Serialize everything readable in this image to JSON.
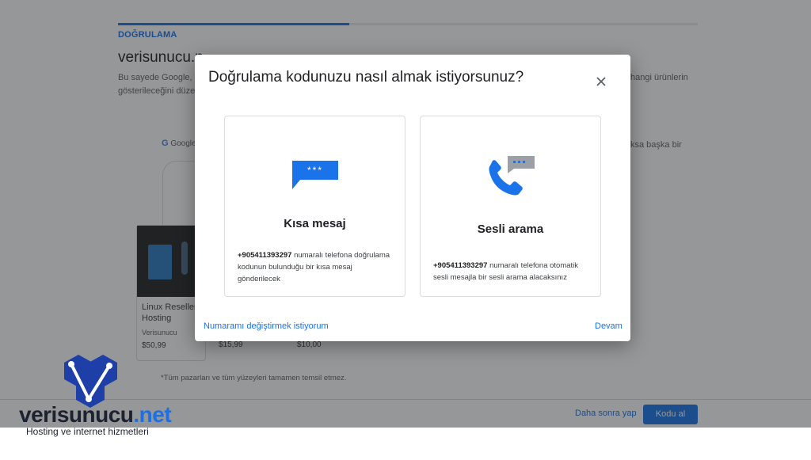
{
  "background": {
    "step_label": "DOĞRULAMA",
    "title": "verisunucu.n",
    "intro_line1": "Bu sayede Google, ve",
    "intro_line2": "gösterileceğini düzen",
    "right_line1": "hangi ürünlerin",
    "right_line2": "ksa başka bir",
    "google_label": "Google",
    "product_title": "Linux Reseller Hosting",
    "product_vendor": "Verisunucu",
    "prices": [
      "$50,99",
      "$15,99",
      "$10,00"
    ],
    "footnote": "*Tüm pazarları ve tüm yüzeyleri tamamen temsil etmez.",
    "later_label": "Daha sonra yap",
    "get_code_label": "Kodu al"
  },
  "dialog": {
    "title": "Doğrulama kodunuzu nasıl almak istiyorsunuz?",
    "close_icon": "close-icon",
    "options": [
      {
        "icon": "sms-bubble-icon",
        "icon_text": "***",
        "title": "Kısa mesaj",
        "phone": "+905411393297",
        "description": " numaralı telefona doğrulama kodunun bulunduğu bir kısa mesaj gönderilecek"
      },
      {
        "icon": "phone-call-icon",
        "title": "Sesli arama",
        "phone": "+905411393297",
        "description": " numaralı telefona otomatik sesli mesajla bir sesli arama alacaksınız"
      }
    ],
    "change_number_label": "Numaramı değiştirmek istiyorum",
    "continue_label": "Devam"
  },
  "watermark": {
    "brand_main": "verisunucu",
    "brand_tld": ".net",
    "tagline": "Hosting ve internet hizmetleri"
  },
  "colors": {
    "accent": "#1a73e8",
    "overlay": "#202124",
    "sms_bubble": "#1a73e8",
    "phone_blue": "#1a73e8",
    "bubble_grey": "#9aa0a6",
    "logo_dark": "#1b2230"
  }
}
